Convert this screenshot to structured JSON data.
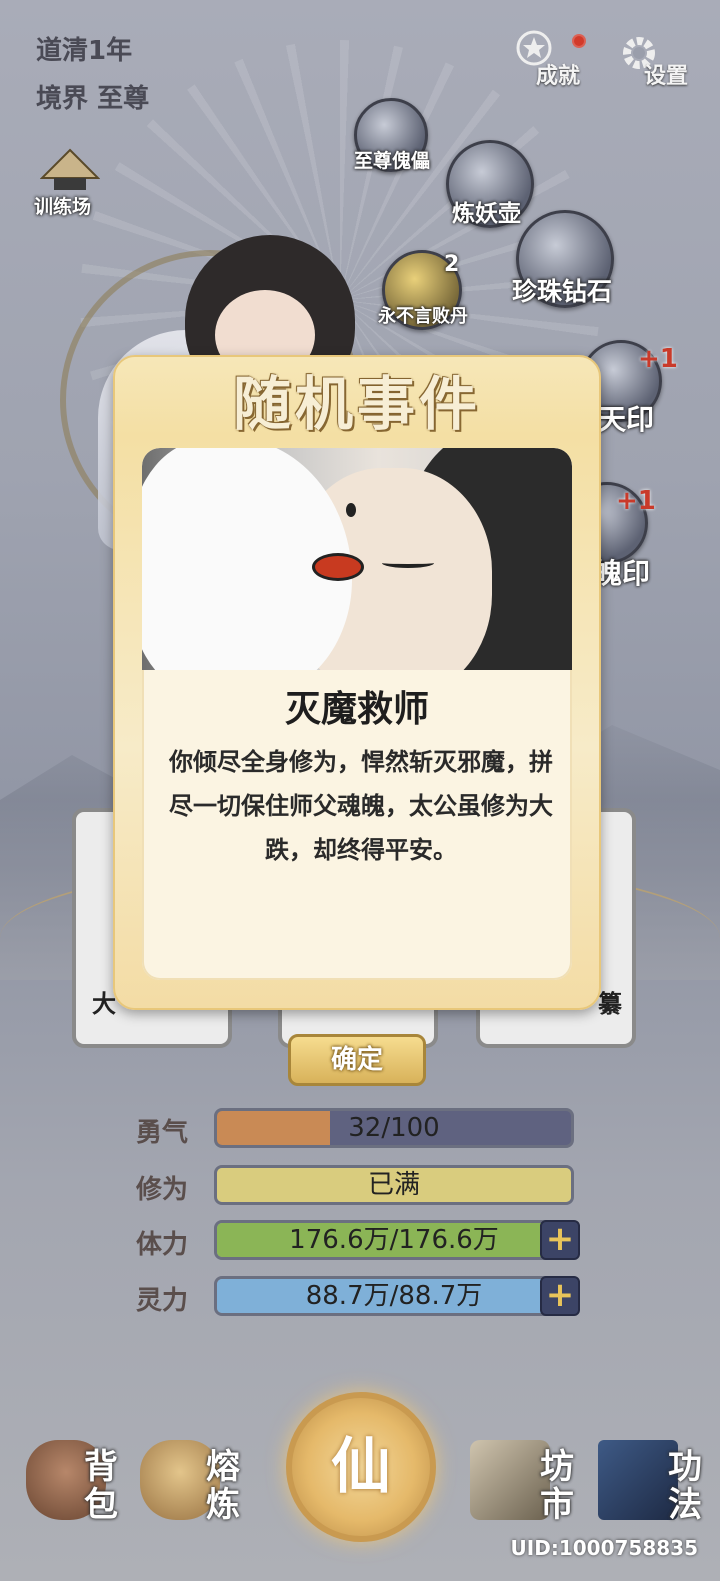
{
  "status": {
    "era": "道清1年",
    "realm_label": "境界",
    "realm_value": "至尊"
  },
  "top_buttons": {
    "achievements": "成就",
    "settings": "设置"
  },
  "training": {
    "label": "训练场"
  },
  "orbs": [
    {
      "label": "至尊傀儡"
    },
    {
      "label": "炼妖壶"
    },
    {
      "label": "珍珠钻石"
    },
    {
      "label": "永不言败丹",
      "count": "2"
    },
    {
      "label": "天印",
      "badge": "+1"
    },
    {
      "label": "魄印",
      "badge": "+1"
    }
  ],
  "event": {
    "title": "随机事件",
    "name": "灭魔救师",
    "description": "你倾尽全身修为，悍然斩灭邪魔，拼尽一切保住师父魂魄，太公虽修为大跌，却终得平安。",
    "confirm": "确定"
  },
  "side_cards": {
    "left_label": "大",
    "right_label": "纂"
  },
  "stats": [
    {
      "label": "勇气",
      "text": "32/100",
      "fill": 0.32,
      "color": "#c98a55",
      "track": "#5f6280",
      "has_plus": false
    },
    {
      "label": "修为",
      "text": "已满",
      "fill": 1.0,
      "color": "#d9cc7e",
      "track": "#5f6280",
      "has_plus": false
    },
    {
      "label": "体力",
      "text": "176.6万/176.6万",
      "fill": 1.0,
      "color": "#8bb556",
      "track": "#5f6280",
      "has_plus": true
    },
    {
      "label": "灵力",
      "text": "88.7万/88.7万",
      "fill": 1.0,
      "color": "#7fb0d8",
      "track": "#5f6280",
      "has_plus": true
    }
  ],
  "nav": {
    "bag": "背包",
    "smelt": "熔炼",
    "center": "仙",
    "market": "坊市",
    "skills": "功法"
  },
  "uid": "UID:1000758835"
}
